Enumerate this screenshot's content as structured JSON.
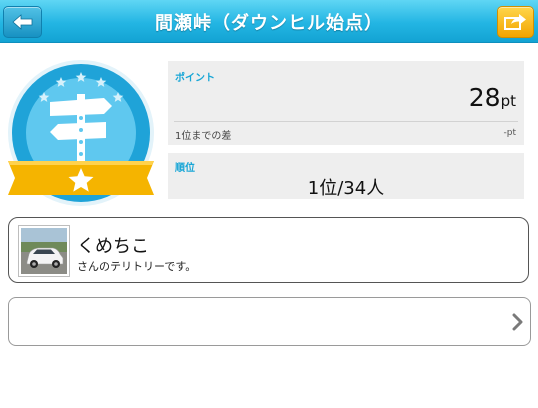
{
  "header": {
    "title": "間瀬峠（ダウンヒル始点）",
    "back_icon": "back-arrow-icon",
    "share_icon": "share-arrow-icon"
  },
  "badge": {
    "icon": "signpost-badge-icon",
    "colors": {
      "ring": "#1fa3d8",
      "inner": "#5fc8ef",
      "ribbon": "#f5b400"
    }
  },
  "points_panel": {
    "label": "ポイント",
    "value": "28",
    "unit": "pt",
    "diff_label": "1位までの差",
    "diff_value": "-pt"
  },
  "rank_panel": {
    "label": "順位",
    "value": "1位/34人"
  },
  "territory": {
    "owner_name": "くめちこ",
    "description": "さんのテリトリーです。"
  },
  "colors": {
    "header": "#23b5e3",
    "accent_text": "#18a6d6",
    "back_button": "#1791c2",
    "share_button": "#f2a400"
  }
}
